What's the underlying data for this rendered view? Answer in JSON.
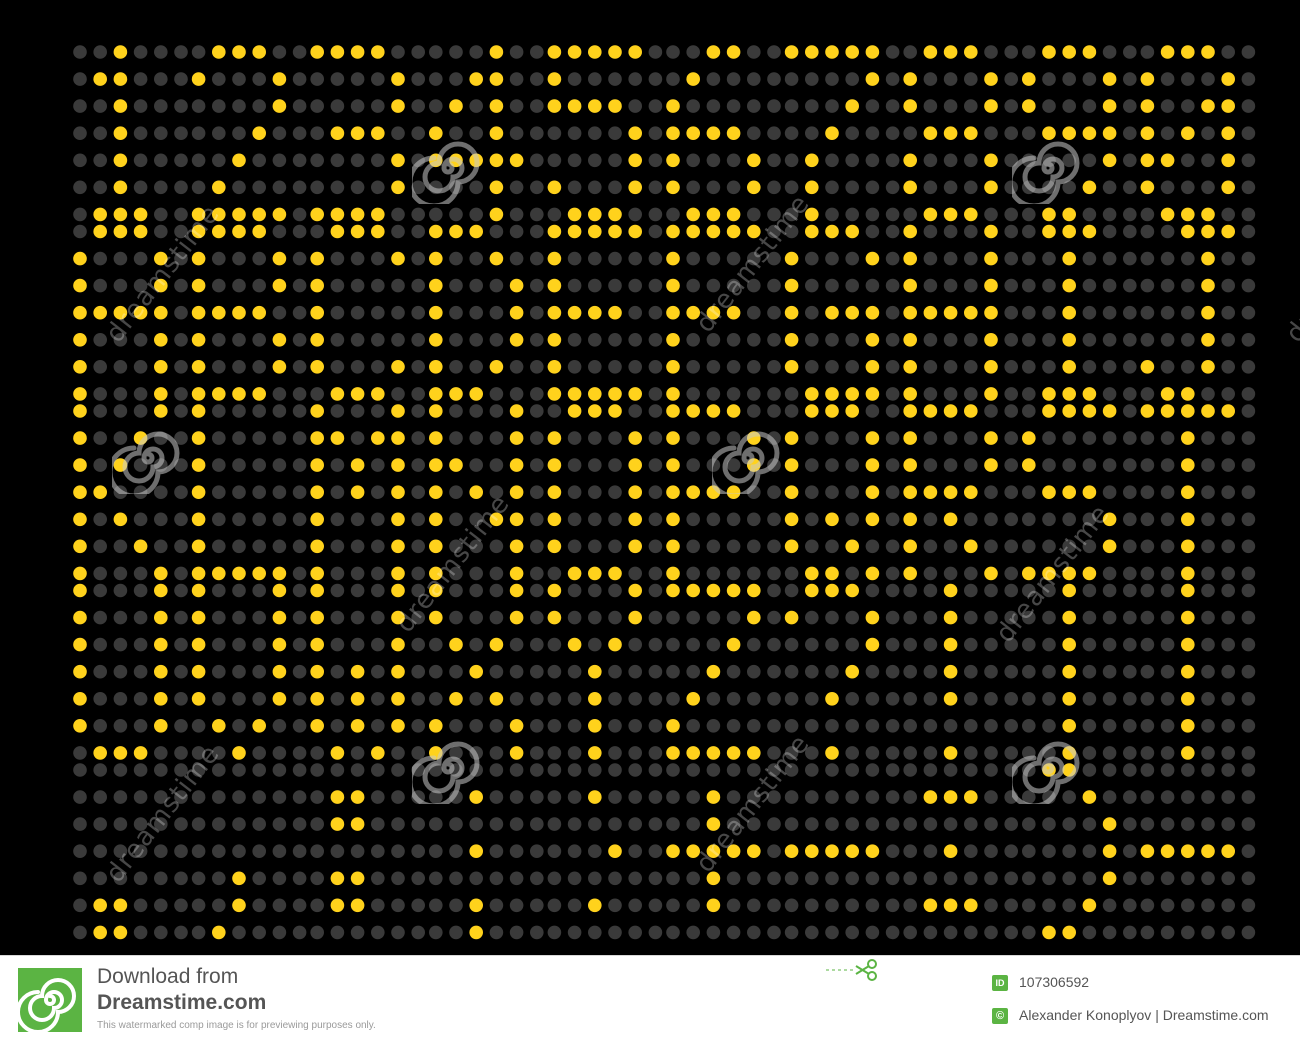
{
  "display": {
    "glyph_rows": [
      [
        "1",
        "2",
        "3",
        "4",
        "5",
        "6",
        "7",
        "8",
        "9",
        "0"
      ],
      [
        "A",
        "B",
        "C",
        "D",
        "E",
        "F",
        "G",
        "H",
        "I",
        "J"
      ],
      [
        "K",
        "L",
        "M",
        "N",
        "O",
        "P",
        "Q",
        "R",
        "S",
        "T"
      ],
      [
        "U",
        "V",
        "W",
        "X",
        "Y",
        "Z",
        "?",
        "!",
        "|",
        "["
      ],
      [
        ".",
        ",",
        ":",
        ";",
        "'",
        "+",
        "-",
        "=",
        "]",
        "-"
      ]
    ],
    "lit_color": "#ffd21c",
    "unlit_color": "#3a3a3a",
    "background_color": "#000000"
  },
  "watermark": {
    "text": "dreamstime"
  },
  "footer": {
    "logo_icon": "dreamstime-spiral-icon",
    "download_line1": "Download from",
    "download_line2": "Dreamstime.com",
    "note": "This watermarked comp image is for previewing purposes only.",
    "scissors_icon": "scissors-icon",
    "id_label": "ID",
    "id_value": "107306592",
    "copyright_symbol": "©",
    "copyright_value": "Alexander Konoplyov | Dreamstime.com",
    "accent_color": "#5bb443"
  }
}
